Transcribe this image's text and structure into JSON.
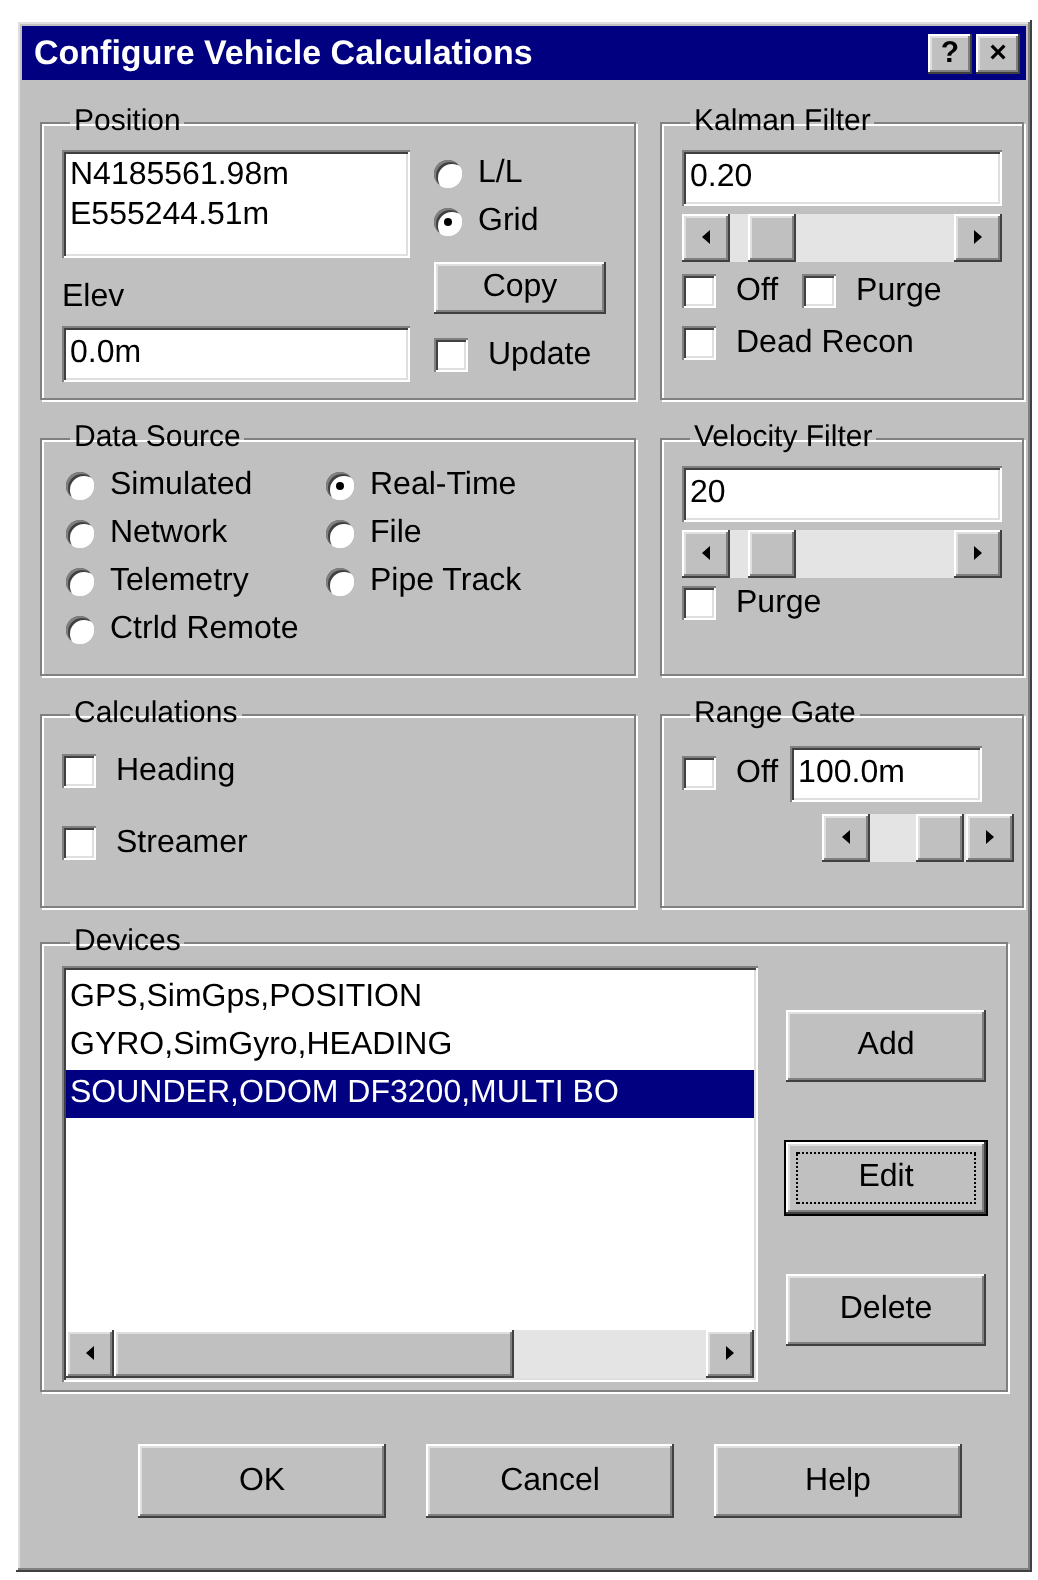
{
  "window": {
    "title": "Configure Vehicle Calculations",
    "title_buttons": [
      {
        "label": "?"
      },
      {
        "label": "×"
      }
    ]
  },
  "position": {
    "title": "Position",
    "coordinates": [
      "N4185561.98m",
      "E555244.51m"
    ],
    "modes": [
      {
        "label": "L/L",
        "selected": false
      },
      {
        "label": "Grid",
        "selected": true
      }
    ],
    "elev_label": "Elev",
    "elev_value": "0.0m",
    "copy_button": "Copy",
    "update": {
      "label": "Update",
      "checked": false
    }
  },
  "kalman_filter": {
    "title": "Kalman Filter",
    "value": "0.20",
    "level": 0.1,
    "checkboxes": [
      {
        "label": "Off",
        "checked": false
      },
      {
        "label": "Purge",
        "checked": false
      },
      {
        "label": "Dead Recon",
        "checked": false
      }
    ]
  },
  "data_source": {
    "title": "Data Source",
    "options": [
      {
        "label": "Simulated",
        "selected": false
      },
      {
        "label": "Real-Time",
        "selected": true
      },
      {
        "label": "Network",
        "selected": false
      },
      {
        "label": "File",
        "selected": false
      },
      {
        "label": "Telemetry",
        "selected": false
      },
      {
        "label": "Pipe Track",
        "selected": false
      },
      {
        "label": "Ctrld Remote",
        "selected": false
      }
    ]
  },
  "velocity_filter": {
    "title": "Velocity Filter",
    "value": "20",
    "level": 0.1,
    "purge": {
      "label": "Purge",
      "checked": false
    }
  },
  "calculations": {
    "title": "Calculations",
    "checkboxes": [
      {
        "label": "Heading",
        "checked": false
      },
      {
        "label": "Streamer",
        "checked": false
      }
    ]
  },
  "range_gate": {
    "title": "Range Gate",
    "off": {
      "label": "Off",
      "checked": false
    },
    "value": "100.0m",
    "level": 0.95
  },
  "devices": {
    "title": "Devices",
    "items": [
      {
        "label": "GPS,SimGps,POSITION",
        "selected": false
      },
      {
        "label": "GYRO,SimGyro,HEADING",
        "selected": false
      },
      {
        "label": "SOUNDER,ODOM DF3200,MULTI BO",
        "selected": true
      }
    ],
    "buttons": [
      {
        "label": "Add",
        "focused": false
      },
      {
        "label": "Edit",
        "focused": true
      },
      {
        "label": "Delete",
        "focused": false
      }
    ]
  },
  "footer_buttons": [
    {
      "label": "OK"
    },
    {
      "label": "Cancel"
    },
    {
      "label": "Help"
    }
  ]
}
